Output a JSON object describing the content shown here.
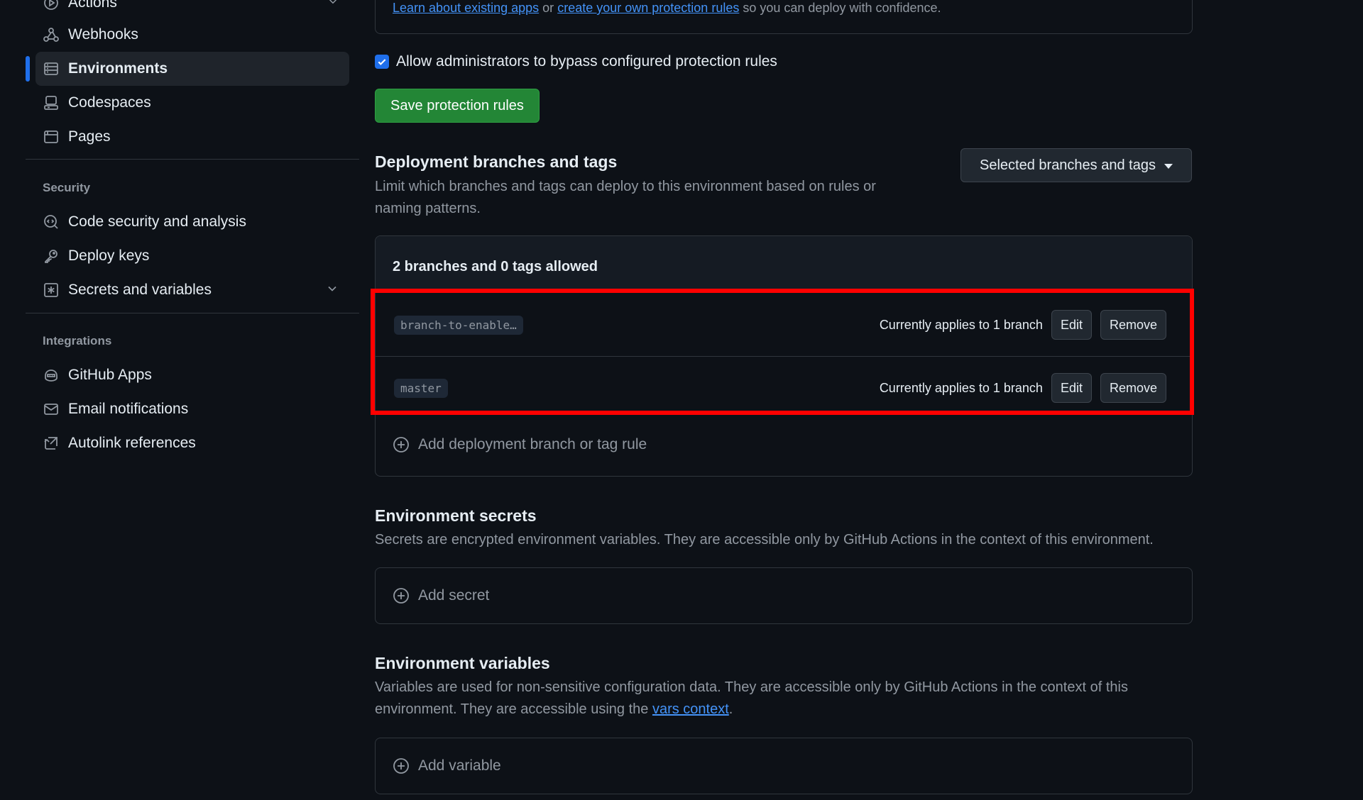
{
  "sidebar": {
    "items_top": [
      {
        "label": "Actions",
        "icon": "play-icon"
      },
      {
        "label": "Webhooks",
        "icon": "webhook-icon"
      },
      {
        "label": "Environments",
        "icon": "server-icon",
        "active": true
      },
      {
        "label": "Codespaces",
        "icon": "codespaces-icon"
      },
      {
        "label": "Pages",
        "icon": "browser-icon"
      }
    ],
    "security_title": "Security",
    "security_items": [
      {
        "label": "Code security and analysis",
        "icon": "codescan-icon"
      },
      {
        "label": "Deploy keys",
        "icon": "key-icon"
      },
      {
        "label": "Secrets and variables",
        "icon": "asterisk-icon"
      }
    ],
    "integrations_title": "Integrations",
    "integration_items": [
      {
        "label": "GitHub Apps",
        "icon": "copilot-icon"
      },
      {
        "label": "Email notifications",
        "icon": "mail-icon"
      },
      {
        "label": "Autolink references",
        "icon": "cross-reference-icon"
      }
    ]
  },
  "protection": {
    "learn_link": "Learn about existing apps",
    "or_text": "or",
    "create_link": "create your own protection rules",
    "trailing_text": "so you can deploy with confidence.",
    "bypass_label": "Allow administrators to bypass configured protection rules",
    "bypass_checked": true,
    "save_button": "Save protection rules"
  },
  "deployment": {
    "title": "Deployment branches and tags",
    "description": "Limit which branches and tags can deploy to this environment based on rules or naming patterns.",
    "dropdown": "Selected branches and tags",
    "summary": "2 branches and 0 tags allowed",
    "rules": [
      {
        "pattern": "branch-to-enable…",
        "applies": "Currently applies to 1 branch",
        "edit": "Edit",
        "remove": "Remove"
      },
      {
        "pattern": "master",
        "applies": "Currently applies to 1 branch",
        "edit": "Edit",
        "remove": "Remove"
      }
    ],
    "add_rule": "Add deployment branch or tag rule"
  },
  "secrets": {
    "title": "Environment secrets",
    "description": "Secrets are encrypted environment variables. They are accessible only by GitHub Actions in the context of this environment.",
    "add": "Add secret"
  },
  "variables": {
    "title": "Environment variables",
    "description_before": "Variables are used for non-sensitive configuration data. They are accessible only by GitHub Actions in the context of this environment. They are accessible using the",
    "link": "vars context",
    "description_after": ".",
    "add": "Add variable"
  },
  "colors": {
    "highlight": "#ff0000",
    "primary_button": "#238636",
    "accent": "#1f6feb"
  }
}
